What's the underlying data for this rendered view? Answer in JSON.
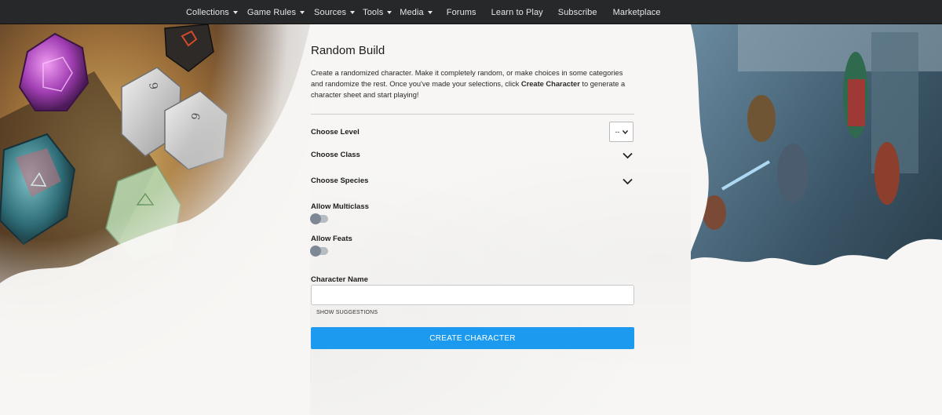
{
  "nav": {
    "items": [
      {
        "label": "Collections",
        "caret": true
      },
      {
        "label": "Game Rules",
        "caret": true
      },
      {
        "label": "Sources",
        "caret": true
      },
      {
        "label": "Tools",
        "caret": true
      },
      {
        "label": "Media",
        "caret": true
      },
      {
        "label": "Forums",
        "caret": false
      },
      {
        "label": "Learn to Play",
        "caret": false
      },
      {
        "label": "Subscribe",
        "caret": false
      },
      {
        "label": "Marketplace",
        "caret": false
      }
    ]
  },
  "page": {
    "title": "Random Build",
    "intro_part1": "Create a randomized character. Make it completely random, or make choices in some categories and randomize the rest. Once you've made your selections, click ",
    "intro_bold": "Create Character",
    "intro_part2": " to generate a character sheet and start playing!"
  },
  "form": {
    "level_label": "Choose Level",
    "level_value": "--",
    "class_label": "Choose Class",
    "species_label": "Choose Species",
    "multiclass_label": "Allow Multiclass",
    "feats_label": "Allow Feats",
    "name_label": "Character Name",
    "name_value": "",
    "suggestions_label": "SHOW SUGGESTIONS",
    "create_label": "CREATE CHARACTER"
  },
  "icons": {
    "chevron": "chevron-down-icon",
    "caret": "caret-down-icon"
  },
  "colors": {
    "nav_bg": "#26282a",
    "accent": "#1b9af0",
    "toggle_track": "#b6bcc3",
    "toggle_knob": "#7d8894"
  }
}
